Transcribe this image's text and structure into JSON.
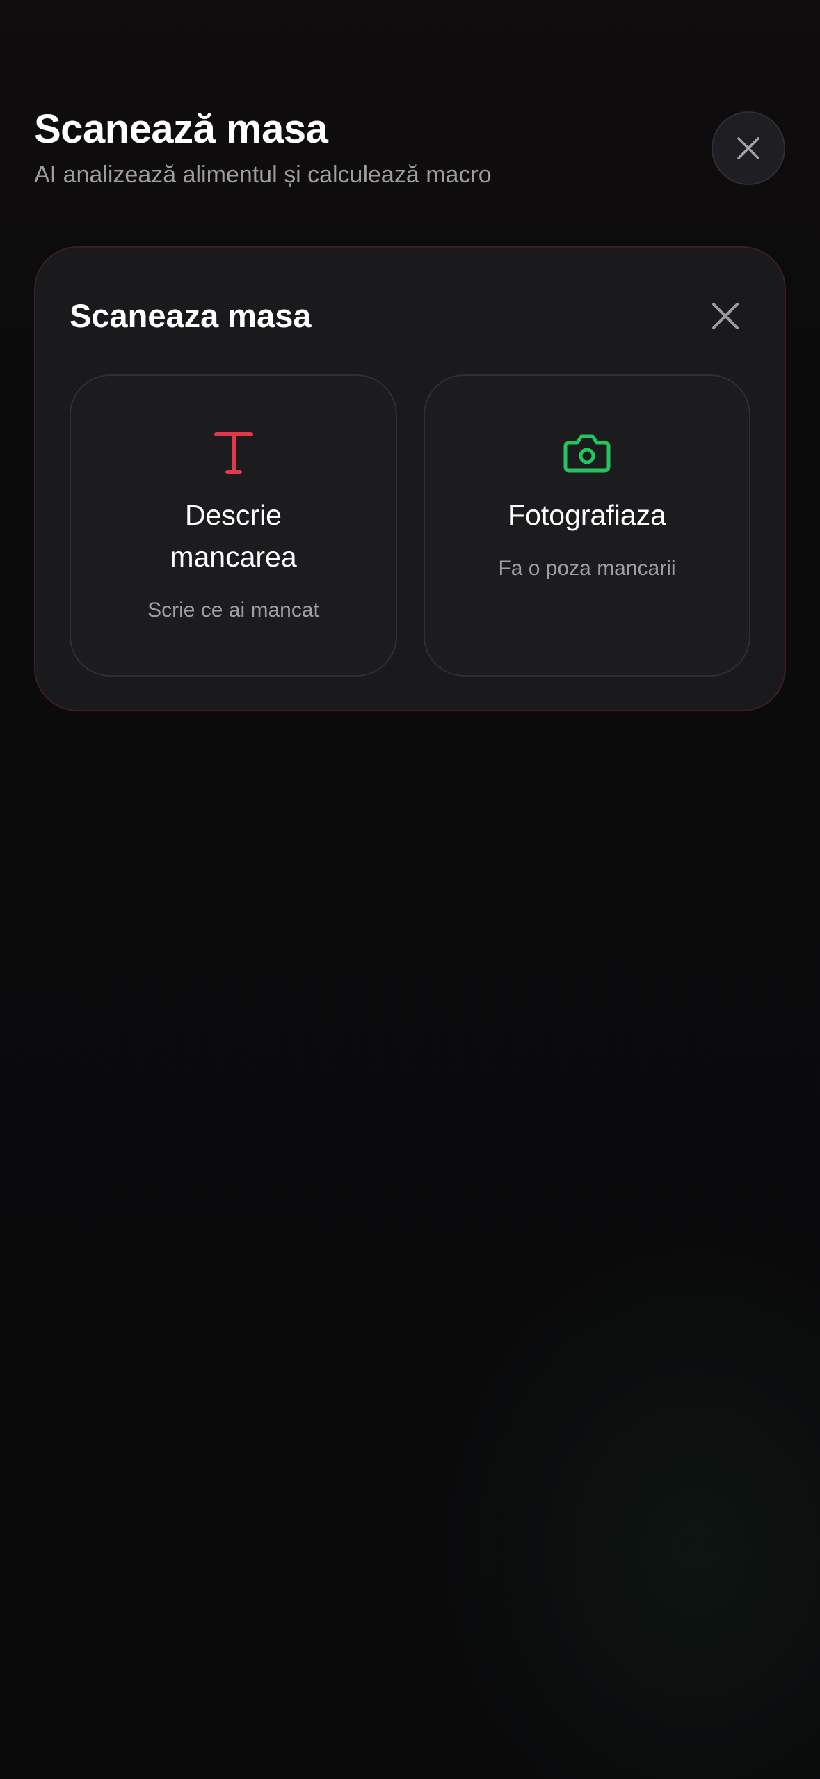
{
  "header": {
    "title": "Scanează masa",
    "subtitle": "AI analizează alimentul și calculează macro",
    "close_icon": "close-icon"
  },
  "modal": {
    "title": "Scaneaza masa",
    "close_icon": "close-icon",
    "options": [
      {
        "id": "describe",
        "icon": "text-icon",
        "icon_color": "#e0394d",
        "title": "Descrie mancarea",
        "subtitle": "Scrie ce ai mancat"
      },
      {
        "id": "photo",
        "icon": "camera-icon",
        "icon_color": "#22c55e",
        "title": "Fotografiaza",
        "subtitle": "Fa o poza mancarii"
      }
    ]
  },
  "colors": {
    "background": "#0a0a0b",
    "card": "#1a1a1d",
    "card_border": "#3b1e25",
    "muted_text": "#9e9ea5"
  }
}
